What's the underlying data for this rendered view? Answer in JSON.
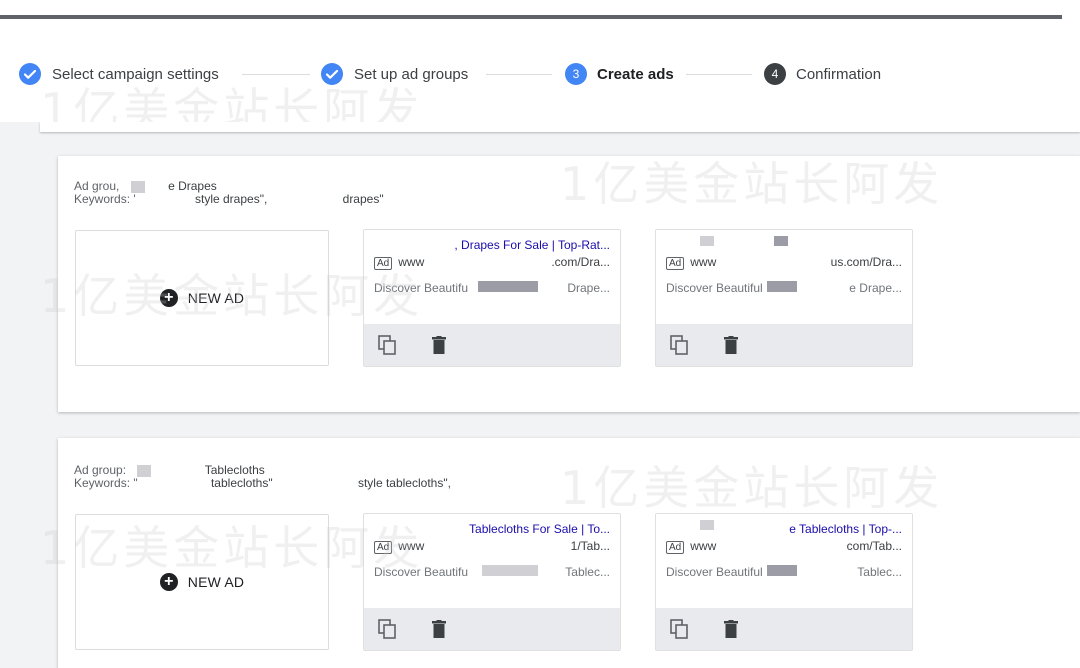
{
  "stepper": {
    "steps": [
      {
        "label": "Select campaign settings",
        "state": "done"
      },
      {
        "label": "Set up ad groups",
        "state": "done"
      },
      {
        "label": "Create ads",
        "number": "3",
        "state": "active"
      },
      {
        "label": "Confirmation",
        "number": "4",
        "state": "pending"
      }
    ]
  },
  "colors": {
    "accent": "#4285f4",
    "pending": "#3c4043",
    "link": "#1a0dab",
    "content_bg": "#f1f3f4"
  },
  "watermark": "1亿美金站长阿发",
  "new_ad_label": "NEW AD",
  "ad_badge": "Ad",
  "groups": [
    {
      "ad_group_label": "Ad grou,",
      "ad_group_value": "e Drapes",
      "keywords_label": "Keywords: '",
      "keywords_value_1": "style drapes\",",
      "keywords_value_2": "drapes\"",
      "ads": [
        {
          "headline": ", Drapes For Sale | Top-Rat...",
          "url_left": "www",
          "url_right": ".com/Dra...",
          "desc_left": "Discover Beautifu",
          "desc_right": "Drape..."
        },
        {
          "headline": "",
          "url_left": "www",
          "url_right": "us.com/Dra...",
          "desc_left": "Discover Beautiful",
          "desc_right": "e Drape..."
        }
      ]
    },
    {
      "ad_group_label": "Ad group:",
      "ad_group_value": "Tablecloths",
      "keywords_label": "Keywords: \"",
      "keywords_value_1": "tablecloths\"",
      "keywords_value_2": "style tablecloths\",",
      "ads": [
        {
          "headline": "Tablecloths For Sale | To...",
          "url_left": "www",
          "url_right": "1/Tab...",
          "desc_left": "Discover Beautifu",
          "desc_right": "Tablec..."
        },
        {
          "headline": "e Tablecloths | Top-...",
          "url_left": "www",
          "url_right": "com/Tab...",
          "desc_left": "Discover Beautiful",
          "desc_right": "Tablec..."
        }
      ]
    }
  ]
}
